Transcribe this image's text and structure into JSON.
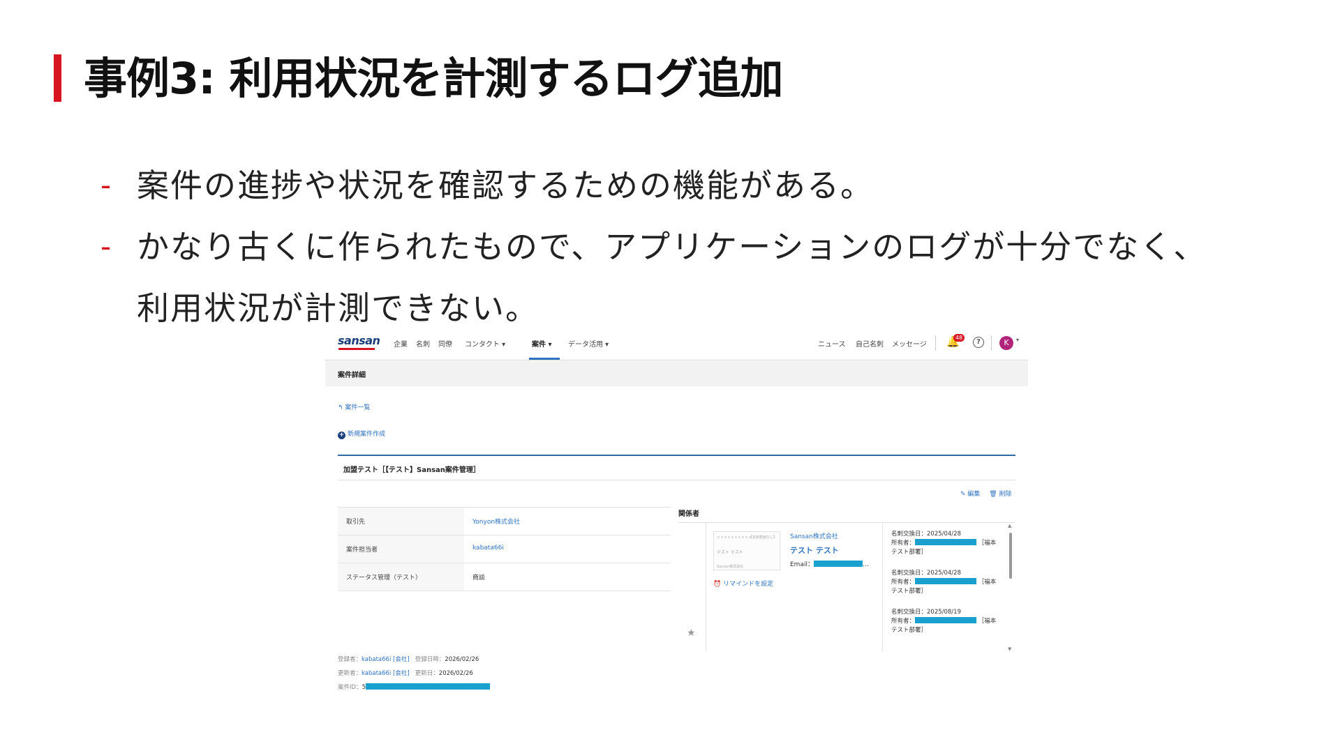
{
  "slide": {
    "title": "事例3: 利用状況を計測するログ追加",
    "bullets": [
      "案件の進捗や状況を確認するための機能がある。",
      "かなり古くに作られたもので、アプリケーションのログが十分でなく、",
      "利用状況が計測できない。"
    ],
    "dash": "-",
    "accent_color": "#d7141f"
  },
  "app": {
    "logo": "sansan",
    "nav": [
      "企業",
      "名刺",
      "同僚",
      "コンタクト ▾",
      "案件 ▾",
      "データ活用 ▾"
    ],
    "right_nav": [
      "ニュース",
      "自己名刺",
      "メッセージ"
    ],
    "notification_count": "48",
    "bell_icon": "🔔",
    "help_icon": "?",
    "avatar_letter": "K",
    "page_header": "案件詳細",
    "back_link": "↰ 案件一覧",
    "new_link": "新規案件作成",
    "deal_title": "加盟テスト［【テスト】Sansan案件管理］",
    "actions": {
      "edit": "✎ 編集",
      "delete": "🗑 削除"
    },
    "info": [
      {
        "key": "取引先",
        "value": "Yonyon株式会社",
        "link": true
      },
      {
        "key": "案件担当者",
        "value": "kabata66i",
        "link": true
      },
      {
        "key": "ステータス管理（テスト）",
        "value": "商談",
        "link": false
      }
    ],
    "contacts": {
      "title": "関係者",
      "card_lines": [
        "ｘｘｘｘｘｘｘｘｘｘ",
        "【名刺表面なし】",
        "テスト テスト",
        "Sansan株式会社"
      ],
      "remind": "⏰ リマインドを設定",
      "company": "Sansan株式会社",
      "name": "テスト テスト",
      "email_label": "Email：",
      "email_tail": "…",
      "history": [
        {
          "date": "名刺交換日：2025/04/28",
          "owner": "所有者：",
          "dept": "［福本",
          "dept2": "テスト部署］"
        },
        {
          "date": "名刺交換日：2025/04/28",
          "owner": "所有者：",
          "dept": "［福本",
          "dept2": "テスト部署］"
        },
        {
          "date": "名刺交換日：2025/08/19",
          "owner": "所有者：",
          "dept": "［福本",
          "dept2": "テスト部署］"
        }
      ]
    },
    "meta": {
      "creator_label": "登録者：",
      "creator": "kabata66i [会社]",
      "created_label": "登録日時：",
      "created": "2026/02/26",
      "updater_label": "更新者：",
      "updater": "kabata66i [会社]",
      "updated_label": "更新日：",
      "updated": "2026/02/26",
      "id_label": "案件ID：",
      "id_prefix": "5"
    },
    "redaction_color": "#1aa0cf"
  }
}
